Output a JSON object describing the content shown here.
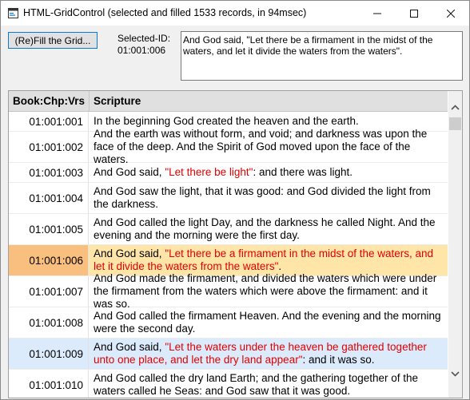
{
  "window": {
    "title": "HTML-GridControl (selected and filled 1533 records, in 94msec)"
  },
  "toolbar": {
    "fill_button_label": "(Re)Fill the Grid...",
    "selected_id_label": "Selected-ID:",
    "selected_id_value": "01:001:006",
    "selected_text": "And God said, \"Let there be a firmament in the midst of the waters, and let it divide the waters from the waters\"."
  },
  "grid": {
    "columns": [
      "Book:Chp:Vrs",
      "Scripture"
    ],
    "rows": [
      {
        "ref": "01:001:001",
        "parts": [
          {
            "t": "In the beginning God created the heaven and the earth."
          }
        ]
      },
      {
        "ref": "01:001:002",
        "parts": [
          {
            "t": "And the earth was without form, and void; and darkness was upon the face of the deep. And the Spirit of God moved upon the face of the waters."
          }
        ]
      },
      {
        "ref": "01:001:003",
        "parts": [
          {
            "t": "And God said, "
          },
          {
            "t": "\"Let there be light\"",
            "q": true
          },
          {
            "t": ": and there was light."
          }
        ]
      },
      {
        "ref": "01:001:004",
        "parts": [
          {
            "t": "And God saw the light, that it was good: and God divided the light from the darkness."
          }
        ]
      },
      {
        "ref": "01:001:005",
        "parts": [
          {
            "t": "And God called the light Day, and the darkness he called Night. And the evening and the morning were the first day."
          }
        ]
      },
      {
        "ref": "01:001:006",
        "state": "selected",
        "parts": [
          {
            "t": "And God said, "
          },
          {
            "t": "\"Let there be a firmament in the midst of the waters, and let it divide the waters from the waters\"",
            "q": true
          },
          {
            "t": "."
          }
        ]
      },
      {
        "ref": "01:001:007",
        "parts": [
          {
            "t": "And God made the firmament, and divided the waters which were under the firmament from the waters which were above the firmament: and it was so."
          }
        ]
      },
      {
        "ref": "01:001:008",
        "parts": [
          {
            "t": "And God called the firmament Heaven. And the evening and the morning were the second day."
          }
        ]
      },
      {
        "ref": "01:001:009",
        "state": "hover",
        "parts": [
          {
            "t": "And God said, "
          },
          {
            "t": "\"Let the waters under the heaven be gathered together unto one place, and let the dry land appear\"",
            "q": true
          },
          {
            "t": ": and it was so."
          }
        ]
      },
      {
        "ref": "01:001:010",
        "parts": [
          {
            "t": "And God called the dry land Earth; and the gathering together of the waters called he Seas: and God saw that it was good."
          }
        ]
      }
    ]
  },
  "icons": {
    "app": "app-window-icon",
    "minimize": "minimize-icon",
    "maximize": "maximize-icon",
    "close": "close-icon",
    "scroll_up": "chevron-up-icon",
    "scroll_down": "chevron-down-icon"
  },
  "colors": {
    "quote": "#e00000",
    "selected_row": "#ffe6a8",
    "selected_ref_cell": "#f9bf7e",
    "hover_row": "#dcebfb",
    "header_bg": "#e0e0e0"
  }
}
